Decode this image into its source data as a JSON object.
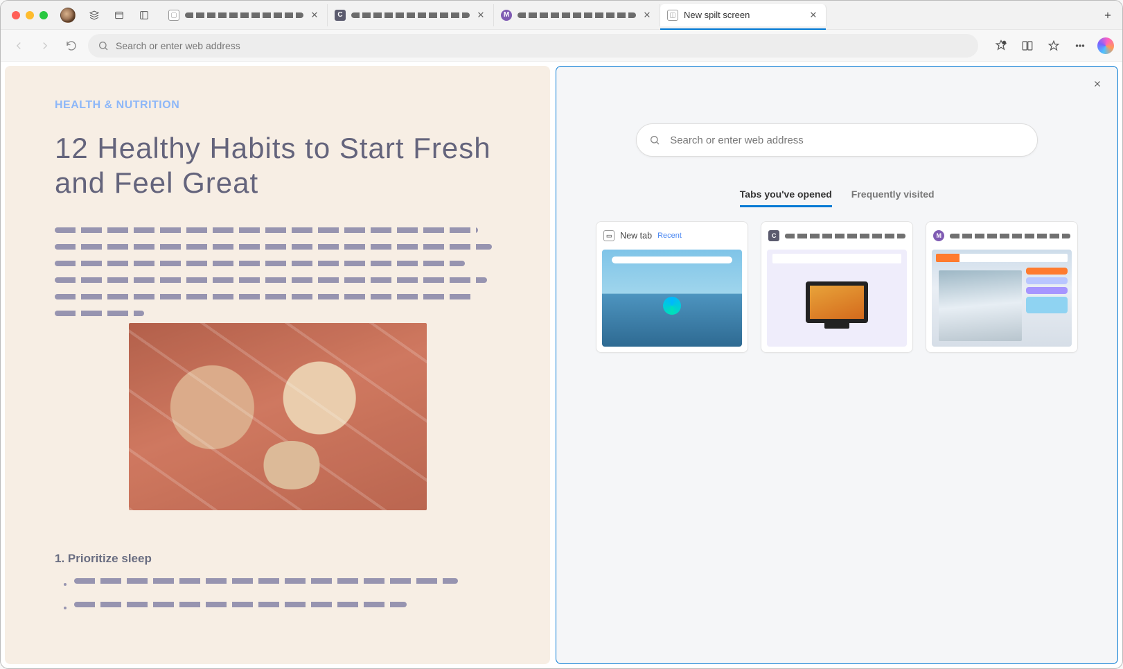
{
  "tabs": [
    {
      "title_placeholder": true
    },
    {
      "title_placeholder": true
    },
    {
      "title_placeholder": true
    },
    {
      "title": "New spilt screen",
      "active": true
    }
  ],
  "address_bar": {
    "placeholder": "Search or enter web address"
  },
  "article": {
    "category": "HEALTH & NUTRITION",
    "title": "12 Healthy Habits to Start Fresh and Feel Great",
    "sub_heading": "1. Prioritize sleep"
  },
  "split": {
    "search_placeholder": "Search or enter web address",
    "tabs_nav": {
      "opened": "Tabs you've opened",
      "frequent": "Frequently visited"
    },
    "cards": [
      {
        "title": "New tab",
        "recent_label": "Recent"
      }
    ]
  }
}
